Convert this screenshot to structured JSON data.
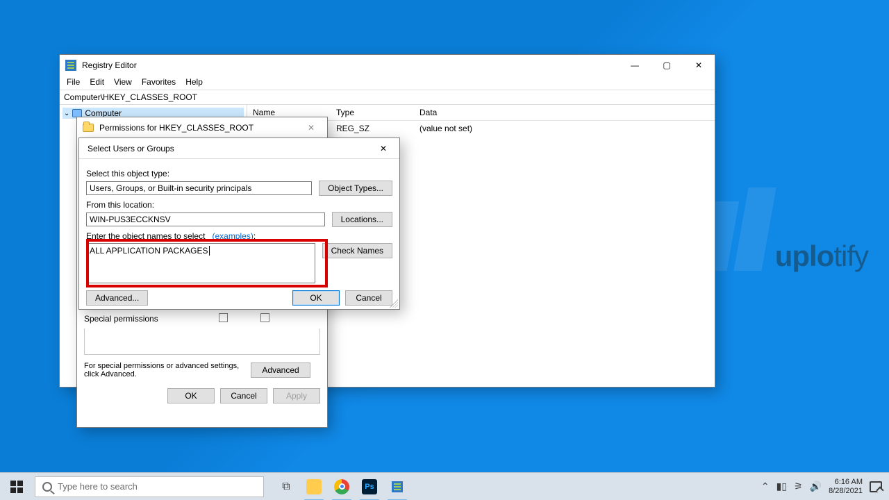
{
  "regedit": {
    "title": "Registry Editor",
    "menu": [
      "File",
      "Edit",
      "View",
      "Favorites",
      "Help"
    ],
    "address": "Computer\\HKEY_CLASSES_ROOT",
    "tree_root": "Computer",
    "columns": {
      "name": "Name",
      "type": "Type",
      "data": "Data"
    },
    "row": {
      "type": "REG_SZ",
      "data": "(value not set)"
    }
  },
  "perm": {
    "title": "Permissions for HKEY_CLASSES_ROOT",
    "special": "Special permissions",
    "adv_text": "For special permissions or advanced settings, click Advanced.",
    "advanced_btn": "Advanced",
    "ok": "OK",
    "cancel": "Cancel",
    "apply": "Apply"
  },
  "selusers": {
    "title": "Select Users or Groups",
    "object_type_label": "Select this object type:",
    "object_type_value": "Users, Groups, or Built-in security principals",
    "object_types_btn": "Object Types...",
    "location_label": "From this location:",
    "location_value": "WIN-PUS3ECCKNSV",
    "locations_btn": "Locations...",
    "enter_names_label": "Enter the object names to select",
    "examples_link": "(examples)",
    "names_value": "ALL APPLICATION PACKAGES",
    "check_names_btn": "Check Names",
    "advanced_btn": "Advanced...",
    "ok": "OK",
    "cancel": "Cancel"
  },
  "taskbar": {
    "search_placeholder": "Type here to search",
    "time": "6:16 AM",
    "date": "8/28/2021"
  },
  "watermark": {
    "a": "uplo",
    "b": "tify"
  }
}
